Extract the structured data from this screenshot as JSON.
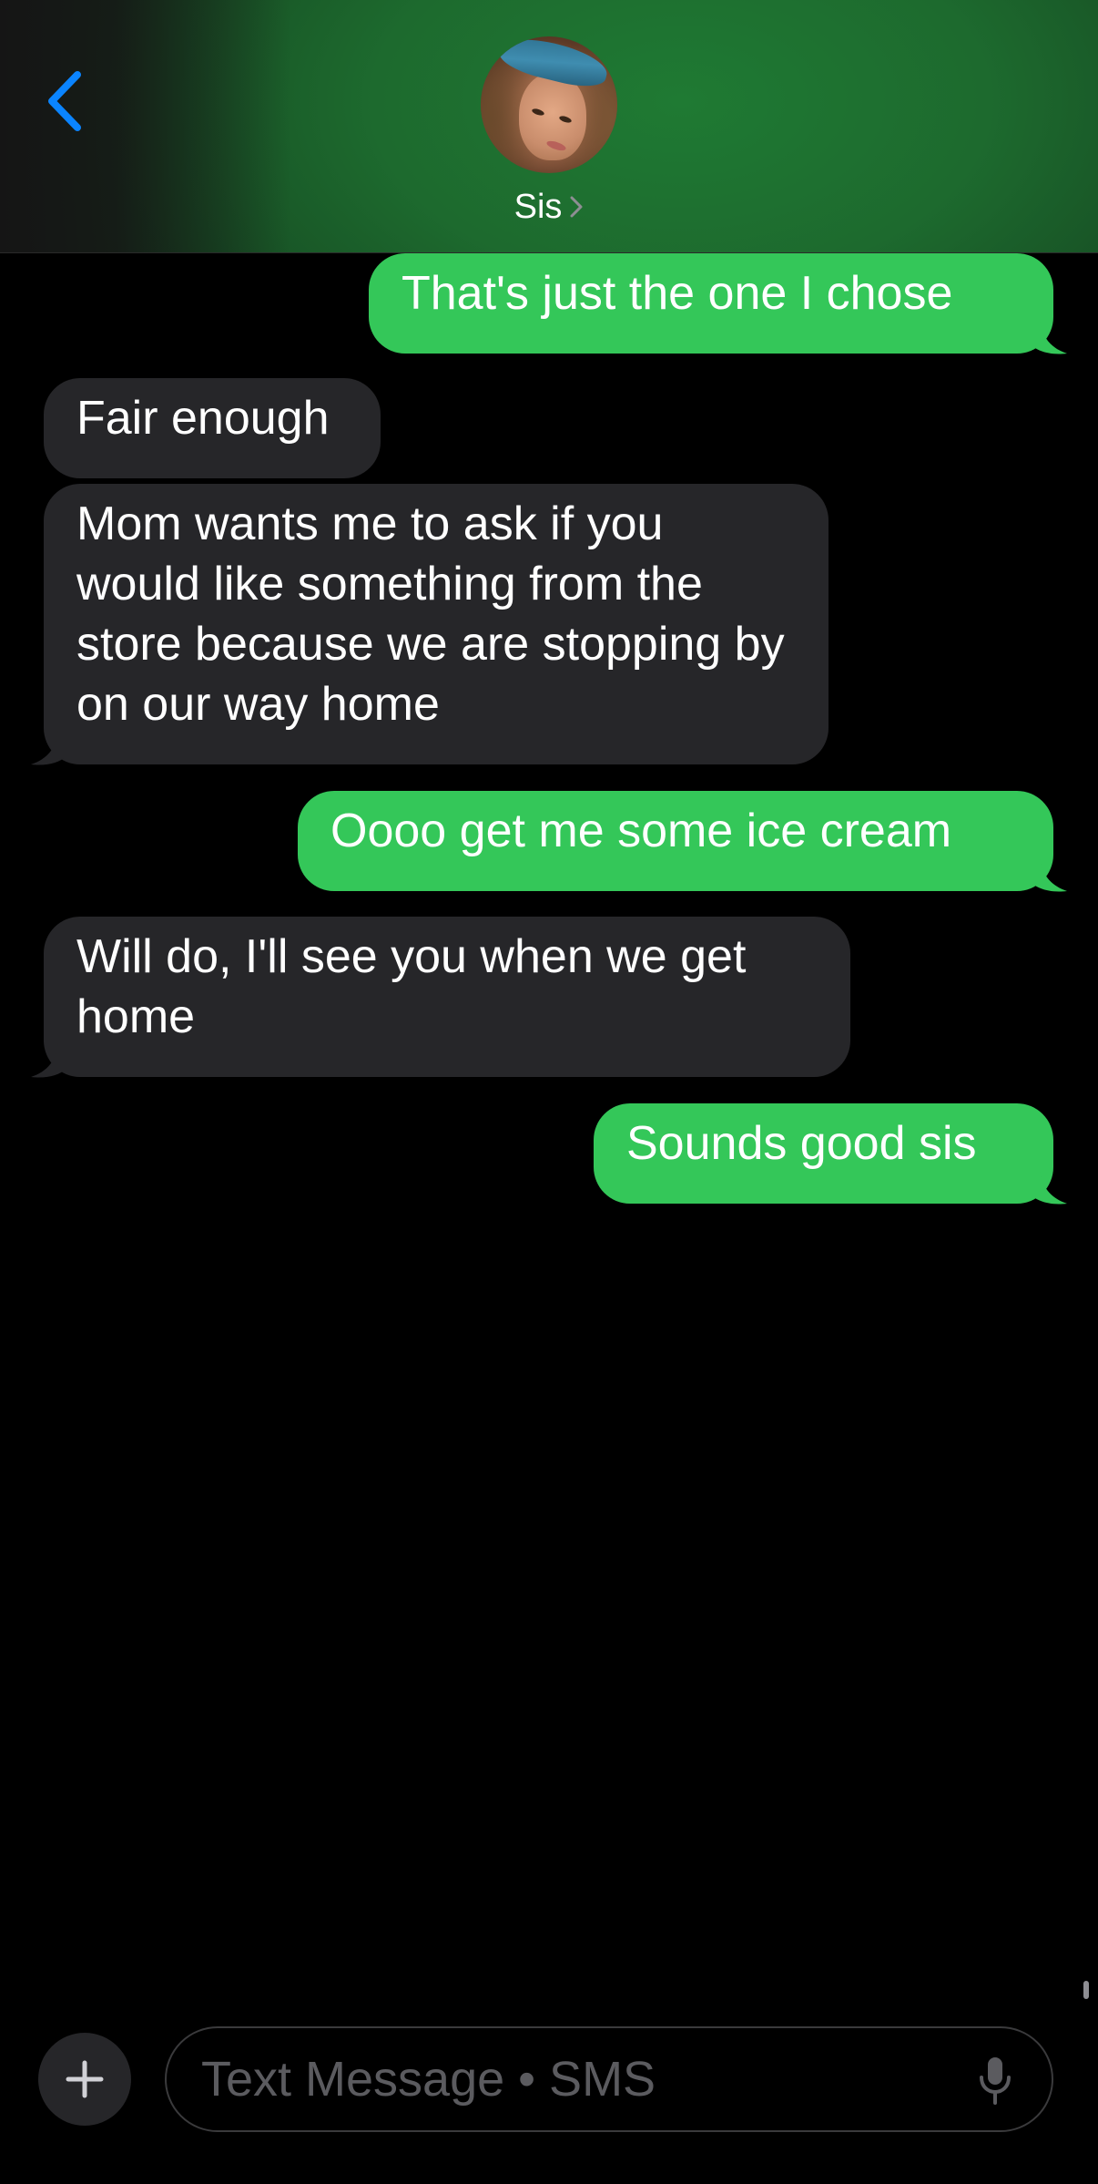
{
  "header": {
    "contact_name": "Sis",
    "avatar_icon": "contact-photo",
    "back_icon": "chevron-left-icon",
    "accent_color": "#0a84ff"
  },
  "messages": [
    {
      "direction": "outgoing",
      "text": "That's just the one I chose"
    },
    {
      "direction": "incoming",
      "text": "Fair enough"
    },
    {
      "direction": "incoming",
      "text": "Mom wants me to ask if you would like something from the store because we are stopping by on our way home"
    },
    {
      "direction": "outgoing",
      "text": "Oooo get me some ice cream"
    },
    {
      "direction": "incoming",
      "text": "Will do, I'll see you when we get home"
    },
    {
      "direction": "outgoing",
      "text": "Sounds good sis"
    }
  ],
  "composer": {
    "placeholder": "Text Message • SMS",
    "value": "",
    "plus_icon": "plus-icon",
    "mic_icon": "microphone-icon"
  },
  "colors": {
    "outgoing_bubble": "#34c759",
    "incoming_bubble": "#262629",
    "background": "#000000"
  }
}
